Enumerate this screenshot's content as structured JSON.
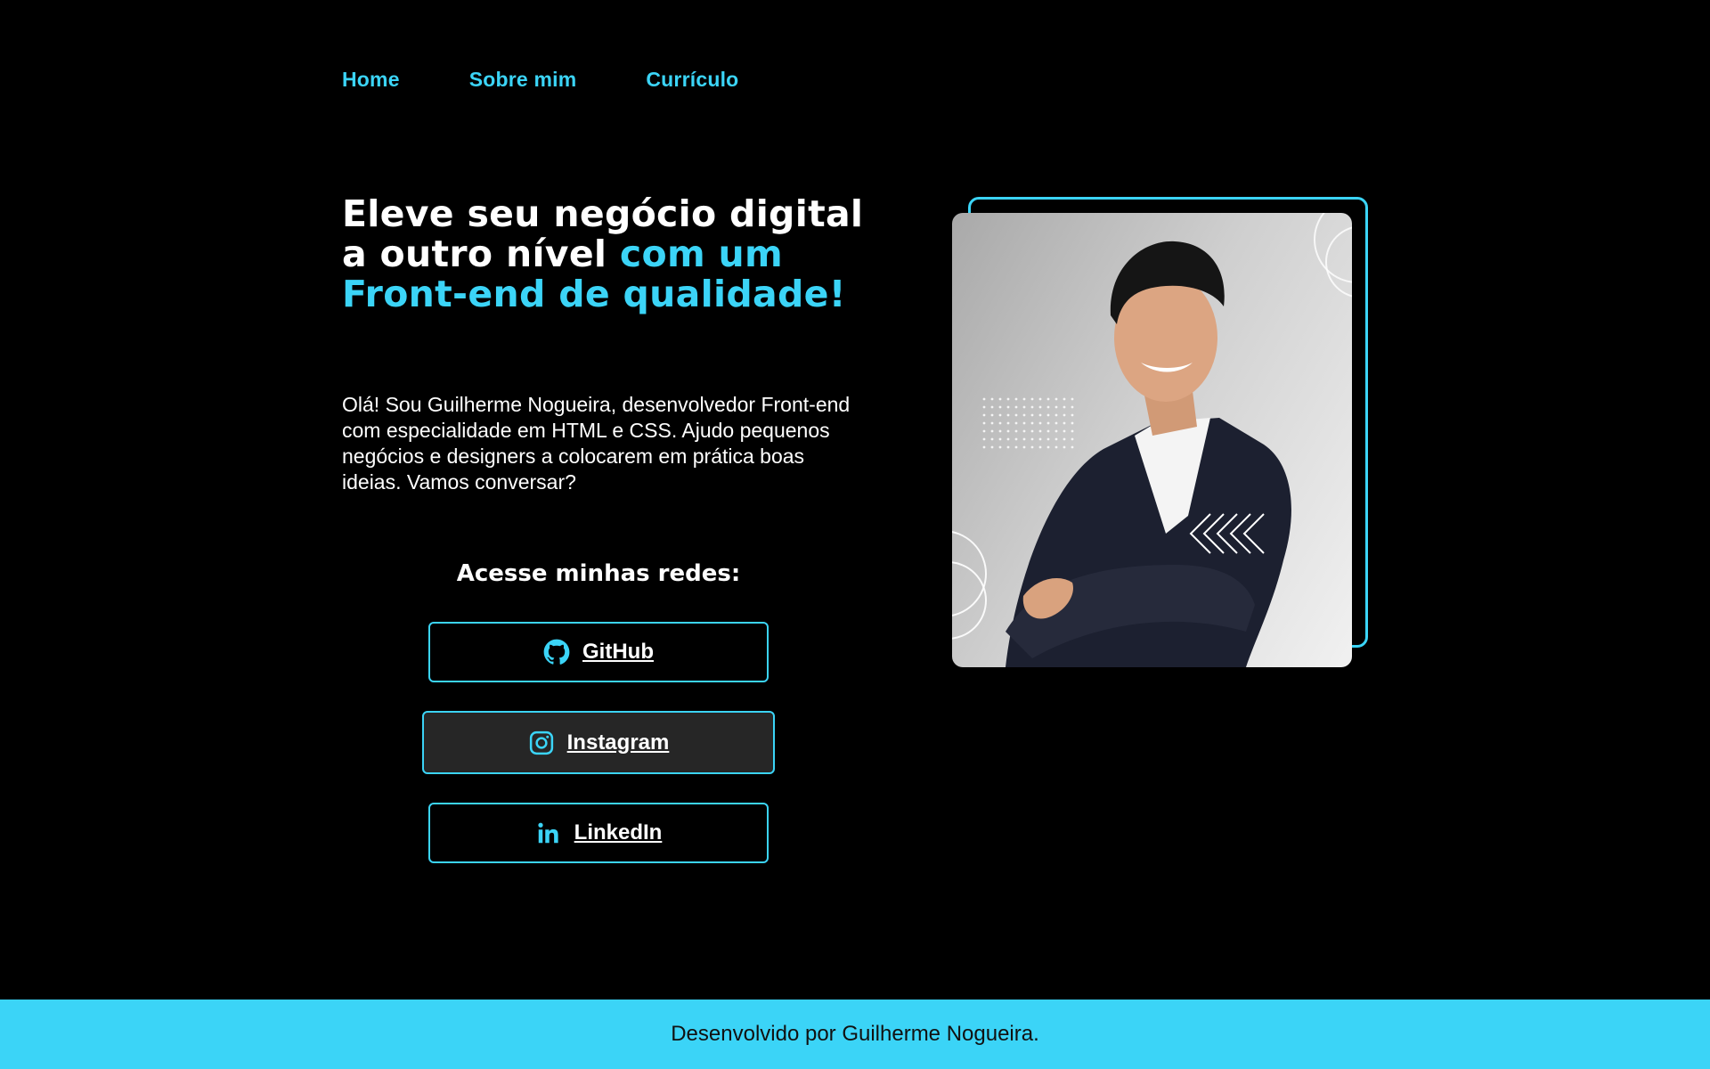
{
  "nav": {
    "items": [
      {
        "label": "Home"
      },
      {
        "label": "Sobre mim"
      },
      {
        "label": "Currículo"
      }
    ]
  },
  "hero": {
    "headline_white": "Eleve seu negócio digital a outro nível ",
    "headline_accent": "com um Front-end de qualidade!",
    "intro": "Olá! Sou Guilherme Nogueira, desenvolvedor Front-end com especialidade em HTML e CSS. Ajudo pequenos negócios e designers a colocarem em prática boas ideias. Vamos conversar?"
  },
  "social": {
    "title": "Acesse minhas redes:",
    "buttons": [
      {
        "label": "GitHub",
        "icon": "github-icon"
      },
      {
        "label": "Instagram",
        "icon": "instagram-icon"
      },
      {
        "label": "LinkedIn",
        "icon": "linkedin-icon"
      }
    ]
  },
  "photo": {
    "subject": "portrait-photo"
  },
  "footer": {
    "text": "Desenvolvido por Guilherme Nogueira."
  },
  "colors": {
    "accent": "#3bd4f7",
    "background": "#000000",
    "button_hover_bg": "#262626",
    "footer_text": "#111111"
  }
}
